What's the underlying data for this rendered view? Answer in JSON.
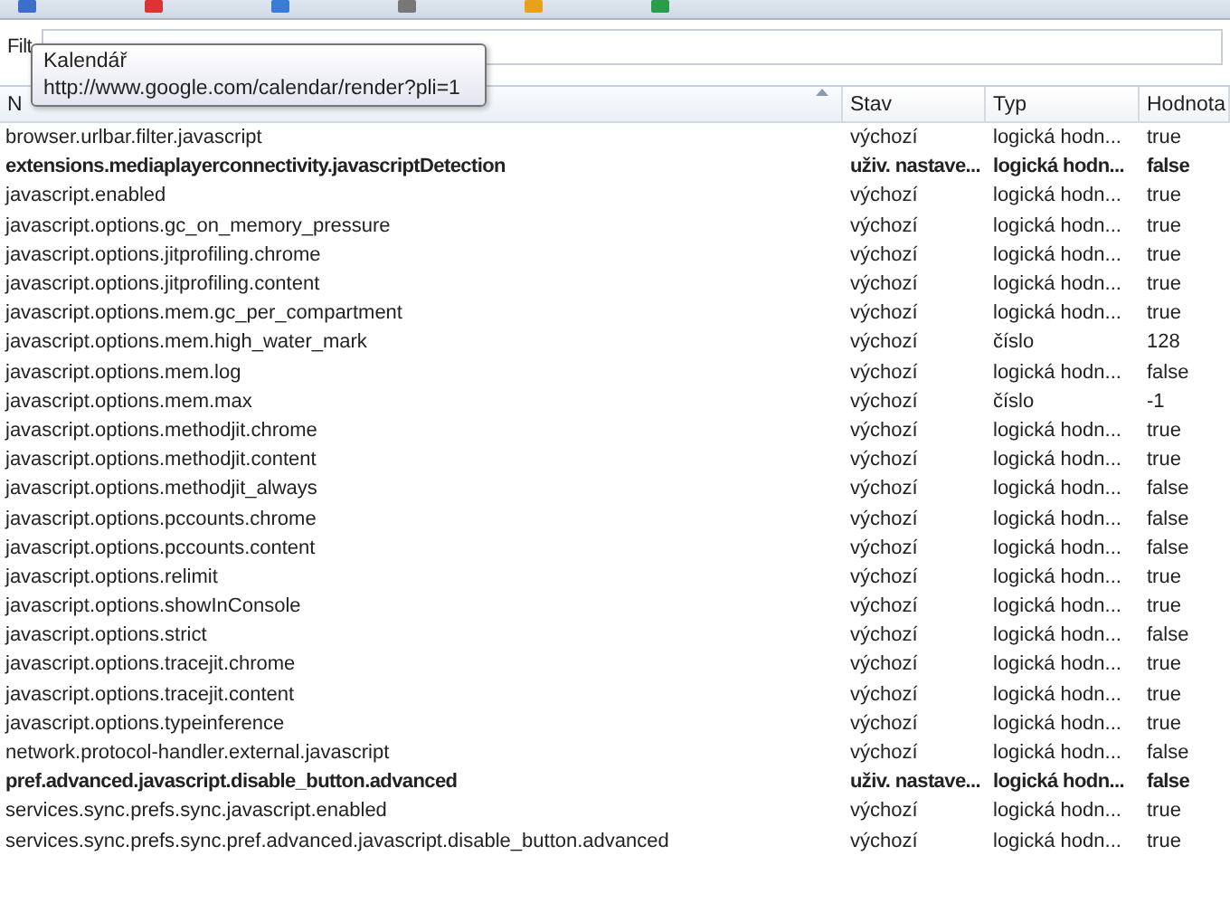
{
  "filter": {
    "label": "Filt"
  },
  "tooltip": {
    "title": "Kalendář",
    "url": "http://www.google.com/calendar/render?pli=1"
  },
  "table": {
    "columns": [
      {
        "label": "N",
        "sorted": true
      },
      {
        "label": "Stav",
        "sorted": false
      },
      {
        "label": "Typ",
        "sorted": false
      },
      {
        "label": "Hodnota",
        "sorted": false
      }
    ],
    "rows": [
      {
        "name": "browser.urlbar.filter.javascript",
        "status": "výchozí",
        "type": "logická hodn...",
        "value": "true",
        "modified": false
      },
      {
        "name": "extensions.mediaplayerconnectivity.javascriptDetection",
        "status": "uživ. nastave...",
        "type": "logická hodn...",
        "value": "false",
        "modified": true
      },
      {
        "name": "javascript.enabled",
        "status": "výchozí",
        "type": "logická hodn...",
        "value": "true",
        "modified": false
      },
      {
        "name": "javascript.options.gc_on_memory_pressure",
        "status": "výchozí",
        "type": "logická hodn...",
        "value": "true",
        "modified": false
      },
      {
        "name": "javascript.options.jitprofiling.chrome",
        "status": "výchozí",
        "type": "logická hodn...",
        "value": "true",
        "modified": false
      },
      {
        "name": "javascript.options.jitprofiling.content",
        "status": "výchozí",
        "type": "logická hodn...",
        "value": "true",
        "modified": false
      },
      {
        "name": "javascript.options.mem.gc_per_compartment",
        "status": "výchozí",
        "type": "logická hodn...",
        "value": "true",
        "modified": false
      },
      {
        "name": "javascript.options.mem.high_water_mark",
        "status": "výchozí",
        "type": "číslo",
        "value": "128",
        "modified": false
      },
      {
        "name": "javascript.options.mem.log",
        "status": "výchozí",
        "type": "logická hodn...",
        "value": "false",
        "modified": false
      },
      {
        "name": "javascript.options.mem.max",
        "status": "výchozí",
        "type": "číslo",
        "value": "-1",
        "modified": false
      },
      {
        "name": "javascript.options.methodjit.chrome",
        "status": "výchozí",
        "type": "logická hodn...",
        "value": "true",
        "modified": false
      },
      {
        "name": "javascript.options.methodjit.content",
        "status": "výchozí",
        "type": "logická hodn...",
        "value": "true",
        "modified": false
      },
      {
        "name": "javascript.options.methodjit_always",
        "status": "výchozí",
        "type": "logická hodn...",
        "value": "false",
        "modified": false
      },
      {
        "name": "javascript.options.pccounts.chrome",
        "status": "výchozí",
        "type": "logická hodn...",
        "value": "false",
        "modified": false
      },
      {
        "name": "javascript.options.pccounts.content",
        "status": "výchozí",
        "type": "logická hodn...",
        "value": "false",
        "modified": false
      },
      {
        "name": "javascript.options.relimit",
        "status": "výchozí",
        "type": "logická hodn...",
        "value": "true",
        "modified": false
      },
      {
        "name": "javascript.options.showInConsole",
        "status": "výchozí",
        "type": "logická hodn...",
        "value": "true",
        "modified": false
      },
      {
        "name": "javascript.options.strict",
        "status": "výchozí",
        "type": "logická hodn...",
        "value": "false",
        "modified": false
      },
      {
        "name": "javascript.options.tracejit.chrome",
        "status": "výchozí",
        "type": "logická hodn...",
        "value": "true",
        "modified": false
      },
      {
        "name": "javascript.options.tracejit.content",
        "status": "výchozí",
        "type": "logická hodn...",
        "value": "true",
        "modified": false
      },
      {
        "name": "javascript.options.typeinference",
        "status": "výchozí",
        "type": "logická hodn...",
        "value": "true",
        "modified": false
      },
      {
        "name": "network.protocol-handler.external.javascript",
        "status": "výchozí",
        "type": "logická hodn...",
        "value": "false",
        "modified": false
      },
      {
        "name": "pref.advanced.javascript.disable_button.advanced",
        "status": "uživ. nastave...",
        "type": "logická hodn...",
        "value": "false",
        "modified": true
      },
      {
        "name": "services.sync.prefs.sync.javascript.enabled",
        "status": "výchozí",
        "type": "logická hodn...",
        "value": "true",
        "modified": false
      },
      {
        "name": "services.sync.prefs.sync.pref.advanced.javascript.disable_button.advanced",
        "status": "výchozí",
        "type": "logická hodn...",
        "value": "true",
        "modified": false
      }
    ]
  }
}
